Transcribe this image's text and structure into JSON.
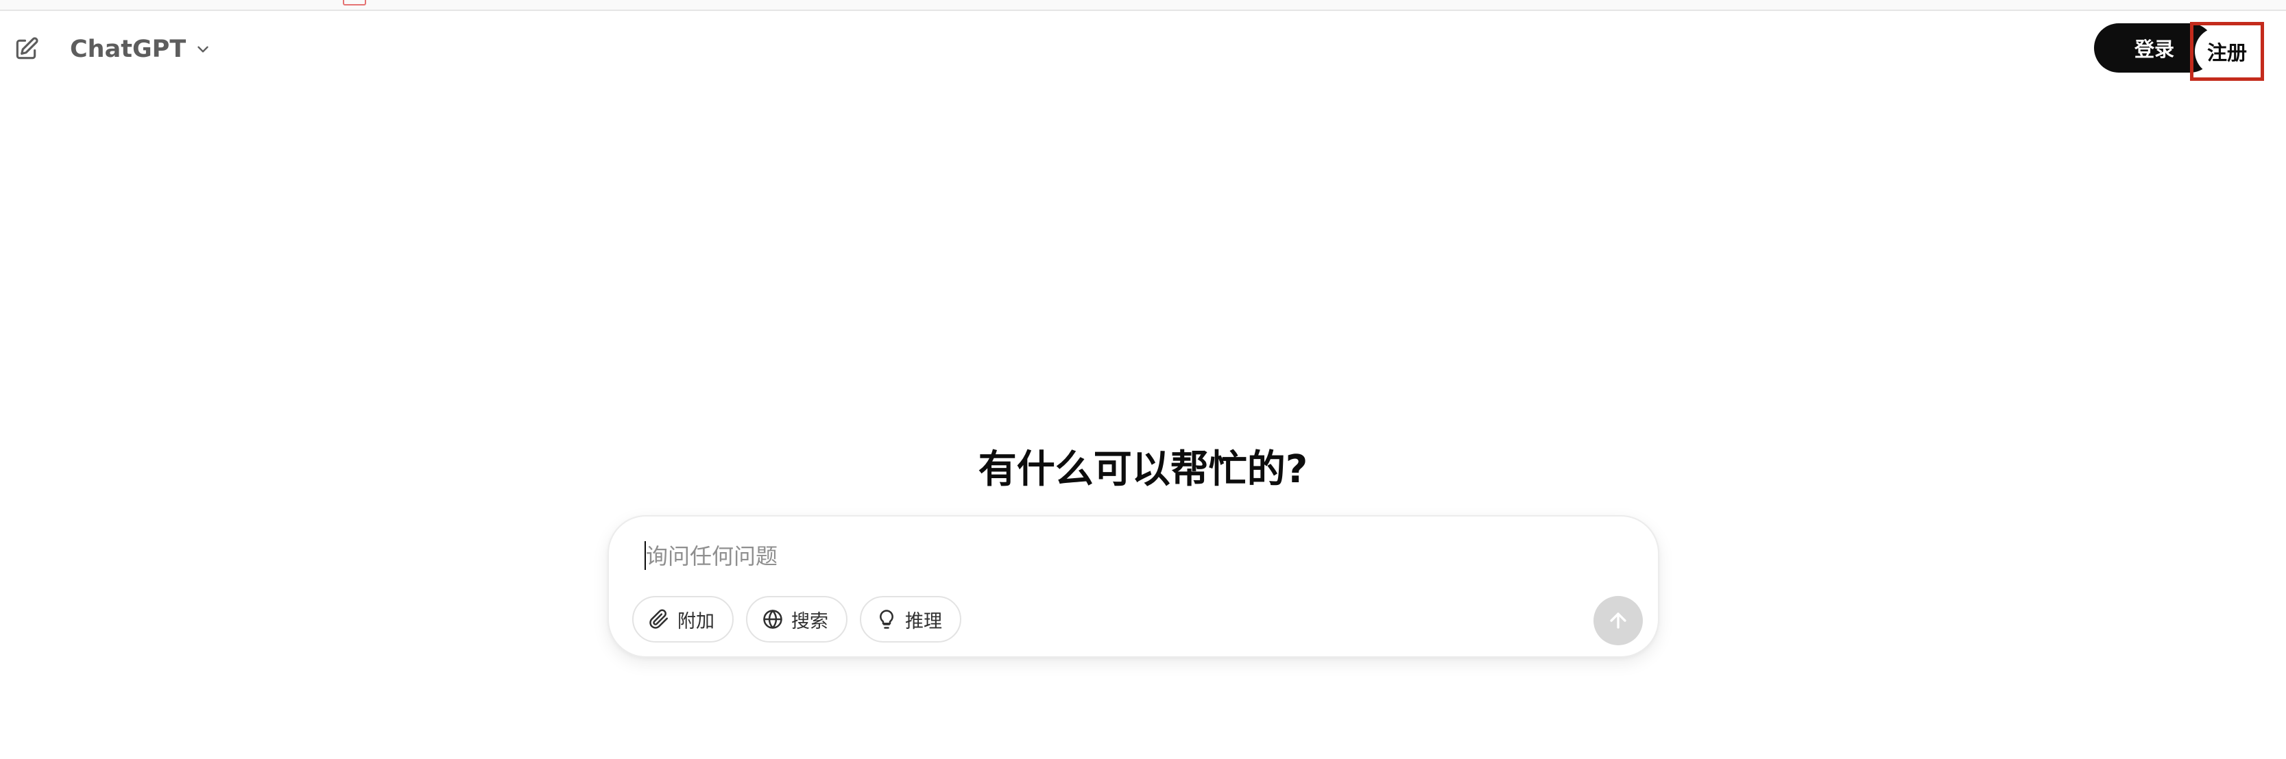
{
  "header": {
    "model_name": "ChatGPT",
    "login_label": "登录",
    "signup_label": "注册"
  },
  "main": {
    "title": "有什么可以帮忙的?"
  },
  "composer": {
    "placeholder": "询问任何问题",
    "tools": [
      {
        "label": "附加",
        "icon": "paperclip-icon"
      },
      {
        "label": "搜索",
        "icon": "globe-icon"
      },
      {
        "label": "推理",
        "icon": "lightbulb-icon"
      }
    ],
    "send_icon": "arrow-up-icon"
  },
  "colors": {
    "primary_button_bg": "#0d0d0d",
    "highlight_box": "#c42b1c",
    "send_button_disabled": "#d7d7d7"
  }
}
